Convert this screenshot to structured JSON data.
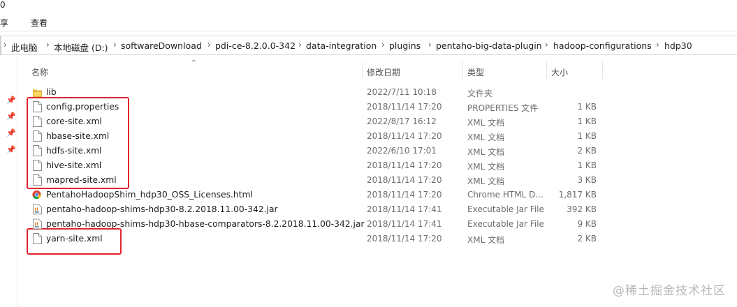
{
  "window": {
    "title_fragment": "0"
  },
  "ribbon": {
    "tabs": [
      "享",
      "查看"
    ]
  },
  "breadcrumb": [
    "此电脑",
    "本地磁盘 (D:)",
    "softwareDownload",
    "pdi-ce-8.2.0.0-342",
    "data-integration",
    "plugins",
    "pentaho-big-data-plugin",
    "hadoop-configurations",
    "hdp30"
  ],
  "columns": {
    "name": "名称",
    "modified": "修改日期",
    "type": "类型",
    "size": "大小"
  },
  "files": [
    {
      "name": "lib",
      "modified": "2022/7/11 10:18",
      "type": "文件夹",
      "size": "",
      "icon": "folder-icon"
    },
    {
      "name": "config.properties",
      "modified": "2018/11/14 17:20",
      "type": "PROPERTIES 文件",
      "size": "1 KB",
      "icon": "file-icon"
    },
    {
      "name": "core-site.xml",
      "modified": "2022/8/17 16:12",
      "type": "XML 文档",
      "size": "1 KB",
      "icon": "file-icon"
    },
    {
      "name": "hbase-site.xml",
      "modified": "2018/11/14 17:20",
      "type": "XML 文档",
      "size": "1 KB",
      "icon": "file-icon"
    },
    {
      "name": "hdfs-site.xml",
      "modified": "2022/6/10 17:01",
      "type": "XML 文档",
      "size": "2 KB",
      "icon": "file-icon"
    },
    {
      "name": "hive-site.xml",
      "modified": "2018/11/14 17:20",
      "type": "XML 文档",
      "size": "1 KB",
      "icon": "file-icon"
    },
    {
      "name": "mapred-site.xml",
      "modified": "2018/11/14 17:20",
      "type": "XML 文档",
      "size": "3 KB",
      "icon": "file-icon"
    },
    {
      "name": "PentahoHadoopShim_hdp30_OSS_Licenses.html",
      "modified": "2018/11/14 17:20",
      "type": "Chrome HTML D...",
      "size": "1,817 KB",
      "icon": "chrome-icon"
    },
    {
      "name": "pentaho-hadoop-shims-hdp30-8.2.2018.11.00-342.jar",
      "modified": "2018/11/14 17:41",
      "type": "Executable Jar File",
      "size": "392 KB",
      "icon": "jar-icon"
    },
    {
      "name": "pentaho-hadoop-shims-hdp30-hbase-comparators-8.2.2018.11.00-342.jar",
      "modified": "2018/11/14 17:41",
      "type": "Executable Jar File",
      "size": "9 KB",
      "icon": "jar-icon"
    },
    {
      "name": "yarn-site.xml",
      "modified": "2018/11/14 17:20",
      "type": "XML 文档",
      "size": "2 KB",
      "icon": "file-icon"
    }
  ],
  "highlight_color": "#e0252e",
  "watermark": "@稀土掘金技术社区"
}
